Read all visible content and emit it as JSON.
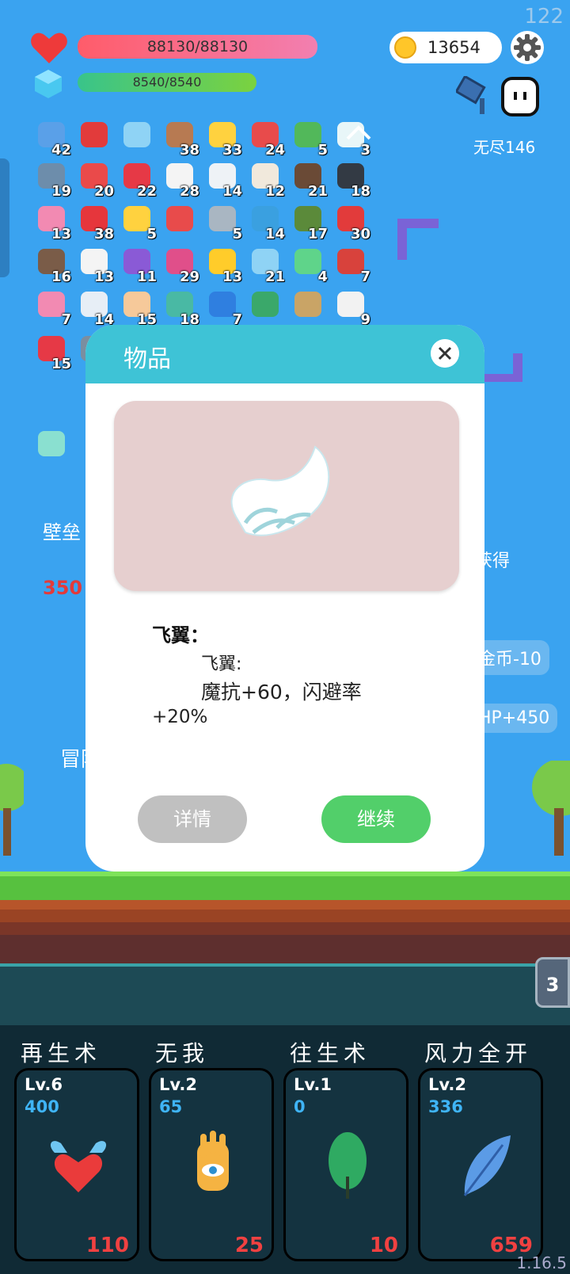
{
  "fps": "122",
  "version": "1.16.5",
  "hud": {
    "hp": "88130/88130",
    "mp": "8540/8540",
    "coins": "13654",
    "mode": "无尽146",
    "icons": [
      "heart-icon",
      "gem-icon",
      "coin-icon",
      "gear-icon",
      "map-flag-icon",
      "ghost-icon"
    ]
  },
  "items": [
    {
      "icon": "star-card",
      "count": "42",
      "color": "#5aa0e8"
    },
    {
      "icon": "magnet",
      "count": "",
      "color": "#e23b3b"
    },
    {
      "icon": "magnifier",
      "count": "",
      "color": "#8fd3f5"
    },
    {
      "icon": "donut",
      "count": "38",
      "color": "#b77a52"
    },
    {
      "icon": "egg",
      "count": "33",
      "color": "#ffd23f"
    },
    {
      "icon": "watermelon",
      "count": "24",
      "color": "#e84b4b"
    },
    {
      "icon": "cash",
      "count": "5",
      "color": "#52b85a"
    },
    {
      "icon": "wing",
      "count": "3",
      "color": "#e8f6f8"
    },
    {
      "icon": "shield",
      "count": "19",
      "color": "#6d8dab"
    },
    {
      "icon": "heart",
      "count": "20",
      "color": "#ea4a4a"
    },
    {
      "icon": "strawberry",
      "count": "22",
      "color": "#e63946"
    },
    {
      "icon": "flower",
      "count": "28",
      "color": "#f4f4f4"
    },
    {
      "icon": "cloud",
      "count": "14",
      "color": "#eef2f6"
    },
    {
      "icon": "cards",
      "count": "12",
      "color": "#f1e9dc"
    },
    {
      "icon": "coconut",
      "count": "21",
      "color": "#6a4a36"
    },
    {
      "icon": "cauldron",
      "count": "18",
      "color": "#333a44"
    },
    {
      "icon": "ice-cream",
      "count": "13",
      "color": "#f28ab2"
    },
    {
      "icon": "apple",
      "count": "38",
      "color": "#e6363c"
    },
    {
      "icon": "bulb",
      "count": "5",
      "color": "#ffd23f"
    },
    {
      "icon": "discount",
      "count": "",
      "color": "#e84b4b"
    },
    {
      "icon": "sword",
      "count": "5",
      "color": "#a9b6c2"
    },
    {
      "icon": "chat",
      "count": "14",
      "color": "#3aa0e0"
    },
    {
      "icon": "grenade",
      "count": "17",
      "color": "#5b8a3a"
    },
    {
      "icon": "sock",
      "count": "30",
      "color": "#e23b3b"
    },
    {
      "icon": "tombstone",
      "count": "16",
      "color": "#7a5c48"
    },
    {
      "icon": "clipboard",
      "count": "13",
      "color": "#f4f4f4"
    },
    {
      "icon": "purple-shield",
      "count": "11",
      "color": "#8a5ad6"
    },
    {
      "icon": "jar",
      "count": "29",
      "color": "#e04f8a"
    },
    {
      "icon": "sunflower",
      "count": "13",
      "color": "#ffcc2a"
    },
    {
      "icon": "potion",
      "count": "21",
      "color": "#8fd3f5"
    },
    {
      "icon": "slime",
      "count": "4",
      "color": "#5fd48a"
    },
    {
      "icon": "red-shield",
      "count": "7",
      "color": "#d8423c"
    },
    {
      "icon": "bottle",
      "count": "7",
      "color": "#f28ab2"
    },
    {
      "icon": "pill",
      "count": "14",
      "color": "#e7eef6"
    },
    {
      "icon": "hand",
      "count": "15",
      "color": "#f6c99a"
    },
    {
      "icon": "ring",
      "count": "18",
      "color": "#49b9a4"
    },
    {
      "icon": "sapphire",
      "count": "7",
      "color": "#2f7fe0"
    },
    {
      "icon": "tent",
      "count": "",
      "color": "#3aa86a"
    },
    {
      "icon": "noose",
      "count": "",
      "color": "#c9a466"
    },
    {
      "icon": "bulb-white",
      "count": "9",
      "color": "#f2f2f2"
    },
    {
      "icon": "capsule",
      "count": "15",
      "color": "#e63946"
    },
    {
      "icon": "axe",
      "count": "",
      "color": "#7b8ea0"
    },
    {
      "icon": "frame",
      "count": "",
      "color": "#8ae0d0"
    }
  ],
  "background_text": {
    "t1": "壁垒",
    "t2": "350",
    "t3": "获得",
    "p1": "金币-10",
    "p2": "HP+450",
    "t4": "冒险"
  },
  "modal": {
    "title": "物品",
    "item_name": "飞翼：",
    "desc_label": "飞翼:",
    "desc_line1": "魔抗+60，闪避率",
    "desc_line2": "+20%",
    "details_button": "详情",
    "continue_button": "继续",
    "image_icon": "wing-icon"
  },
  "badge": "3",
  "skills": [
    {
      "name": "再生术",
      "level": "Lv.6",
      "cost": "400",
      "count": "110",
      "icon": "winged-heart-icon"
    },
    {
      "name": "无我",
      "level": "Lv.2",
      "cost": "65",
      "count": "25",
      "icon": "eye-hand-icon"
    },
    {
      "name": "往生术",
      "level": "Lv.1",
      "cost": "0",
      "count": "10",
      "icon": "leaf-icon"
    },
    {
      "name": "风力全开",
      "level": "Lv.2",
      "cost": "336",
      "count": "659",
      "icon": "feather-icon"
    }
  ]
}
